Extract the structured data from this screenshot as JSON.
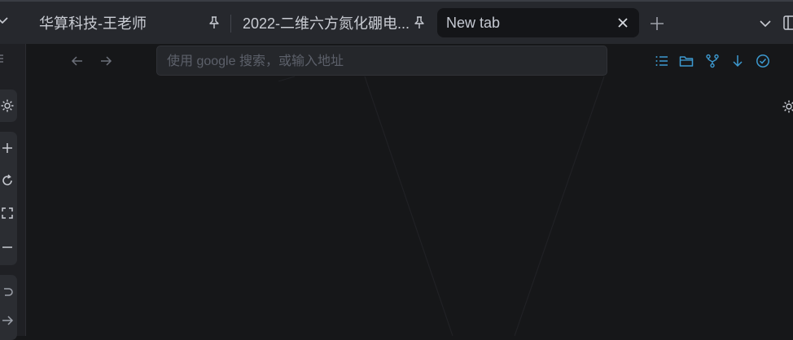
{
  "tabs": [
    {
      "title": "华算科技-王老师",
      "pinned": true
    },
    {
      "title": "2022-二维六方氮化硼电...",
      "pinned": true
    },
    {
      "title": "New tab",
      "active": true
    }
  ],
  "search": {
    "placeholder": "使用 google 搜索，或输入地址",
    "value": ""
  },
  "icons": {
    "toolbar": [
      "list-icon",
      "folder-icon",
      "fork-icon",
      "download-icon",
      "check-circle-icon"
    ],
    "left_strip": [
      "gear-icon",
      "plus-icon",
      "refresh-icon",
      "fullscreen-icon",
      "minus-icon",
      "undo-icon",
      "arrow-right-icon"
    ]
  },
  "colors": {
    "accent": "#3d9ad1",
    "background": "#161719",
    "tabbar": "#26282d"
  }
}
